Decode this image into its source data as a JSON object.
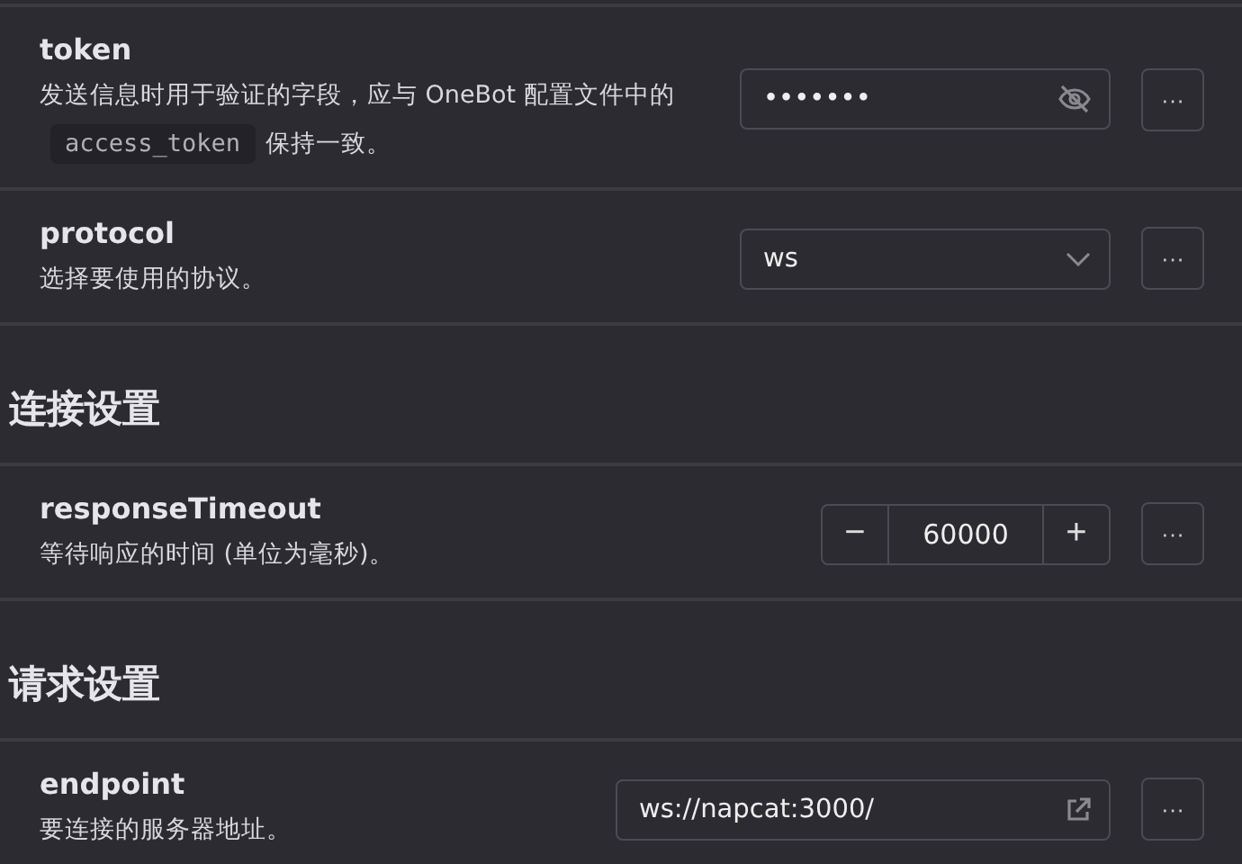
{
  "sections": [
    {
      "items": [
        {
          "kind": "password",
          "title": "token",
          "description": [
            {
              "kind": "text",
              "text": "发送信息时用于验证的字段，应与 OneBot 配置文件中的"
            },
            {
              "kind": "code",
              "text": "access_token"
            },
            {
              "kind": "text",
              "text": "保持一致。"
            }
          ],
          "value": "•••••••",
          "more": "···"
        },
        {
          "kind": "select",
          "title": "protocol",
          "description": [
            {
              "kind": "text",
              "text": "选择要使用的协议。"
            }
          ],
          "value": "ws",
          "more": "···"
        }
      ]
    },
    {
      "heading": "连接设置",
      "items": [
        {
          "kind": "number",
          "title": "responseTimeout",
          "description": [
            {
              "kind": "text",
              "text": "等待响应的时间 (单位为毫秒)。"
            }
          ],
          "value": "60000",
          "minus": "−",
          "plus": "+",
          "more": "···"
        }
      ]
    },
    {
      "heading": "请求设置",
      "items": [
        {
          "kind": "url",
          "title": "endpoint",
          "description": [
            {
              "kind": "text",
              "text": "要连接的服务器地址。"
            }
          ],
          "value": "ws://napcat:3000/",
          "more": "···"
        }
      ]
    }
  ]
}
